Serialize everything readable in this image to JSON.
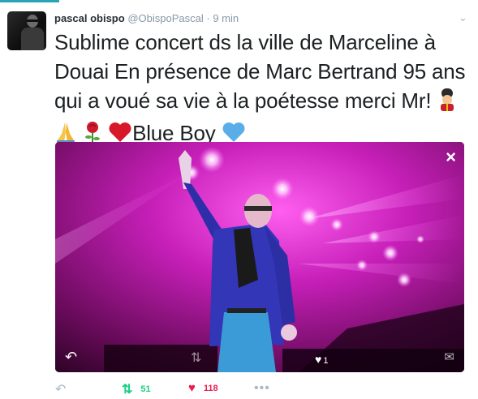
{
  "tweet": {
    "author_name": "pascal obispo",
    "author_handle": "@ObispoPascal",
    "separator": "·",
    "time": "9 min",
    "text": "Sublime concert ds la ville de Marceline à Douai En présence de Marc Bertrand 95 ans qui a voué sa vie à la poétesse merci Mr!",
    "emojis": [
      "guardsman-emoji",
      "folded-hands-emoji",
      "rose-emoji",
      "red-heart-emoji"
    ],
    "text_tail": "Blue Boy",
    "tail_emoji": "blue-heart-emoji"
  },
  "media": {
    "close_icon": "×",
    "like_count": "1"
  },
  "actions": {
    "retweet_count": "51",
    "like_count": "118",
    "more_label": "•••"
  },
  "colors": {
    "accent_teal": "#2aa3b7",
    "retweet_green": "#19cf86",
    "like_red": "#e81c4f",
    "meta_gray": "#8899a6"
  }
}
